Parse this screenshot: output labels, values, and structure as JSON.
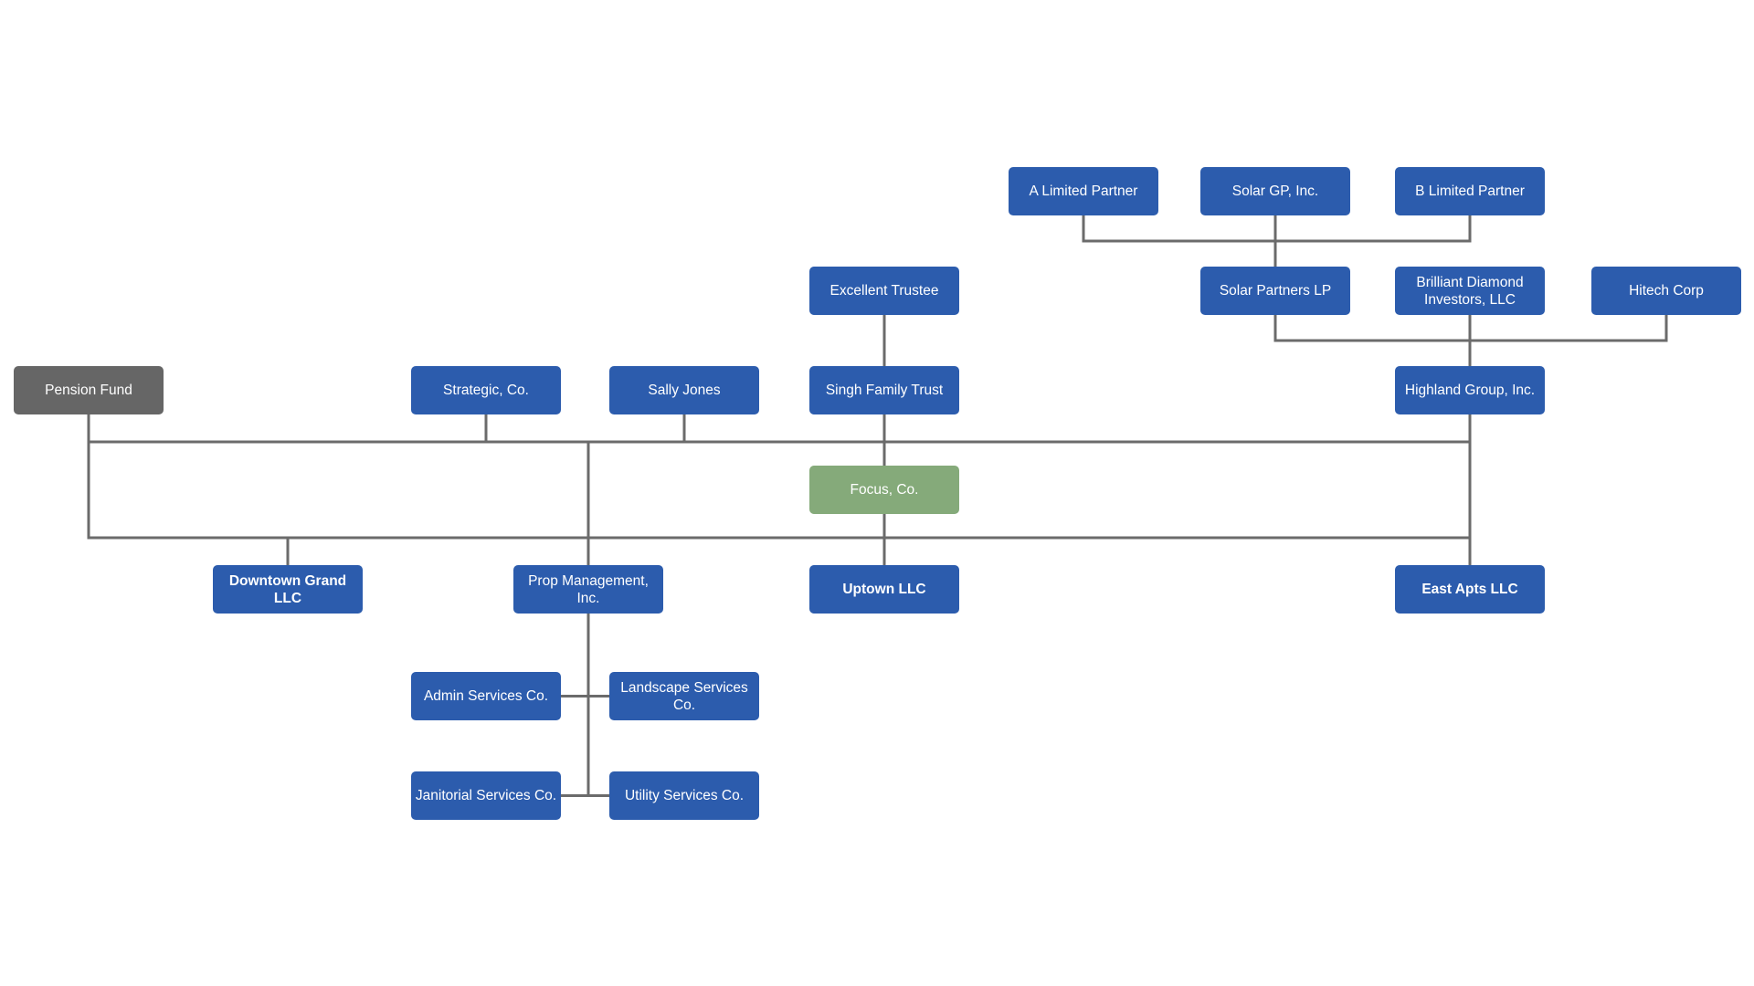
{
  "diagram": {
    "type": "org-chart",
    "colors": {
      "entity": "#2c5cad",
      "focus": "#85aa7a",
      "external": "#666666",
      "line": "#6b6b6b",
      "text": "#ffffff"
    },
    "nodes": [
      {
        "id": "a-limited-partner",
        "label": "A Limited Partner",
        "kind": "entity",
        "bold": false
      },
      {
        "id": "solar-gp",
        "label": "Solar GP, Inc.",
        "kind": "entity",
        "bold": false
      },
      {
        "id": "b-limited-partner",
        "label": "B Limited Partner",
        "kind": "entity",
        "bold": false
      },
      {
        "id": "excellent-trustee",
        "label": "Excellent Trustee",
        "kind": "entity",
        "bold": false
      },
      {
        "id": "solar-partners-lp",
        "label": "Solar Partners LP",
        "kind": "entity",
        "bold": false
      },
      {
        "id": "brilliant-diamond",
        "label": "Brilliant Diamond Investors, LLC",
        "kind": "entity",
        "bold": false
      },
      {
        "id": "hitech-corp",
        "label": "Hitech Corp",
        "kind": "entity",
        "bold": false
      },
      {
        "id": "pension-fund",
        "label": "Pension Fund",
        "kind": "external",
        "bold": false
      },
      {
        "id": "strategic-co",
        "label": "Strategic, Co.",
        "kind": "entity",
        "bold": false
      },
      {
        "id": "sally-jones",
        "label": "Sally Jones",
        "kind": "entity",
        "bold": false
      },
      {
        "id": "singh-family-trust",
        "label": "Singh Family Trust",
        "kind": "entity",
        "bold": false
      },
      {
        "id": "highland-group",
        "label": "Highland Group, Inc.",
        "kind": "entity",
        "bold": false
      },
      {
        "id": "focus-co",
        "label": "Focus, Co.",
        "kind": "focus",
        "bold": false
      },
      {
        "id": "downtown-grand",
        "label": "Downtown Grand LLC",
        "kind": "entity",
        "bold": true
      },
      {
        "id": "prop-management",
        "label": "Prop Management, Inc.",
        "kind": "entity",
        "bold": false
      },
      {
        "id": "uptown-llc",
        "label": "Uptown LLC",
        "kind": "entity",
        "bold": true
      },
      {
        "id": "east-apts",
        "label": "East Apts LLC",
        "kind": "entity",
        "bold": true
      },
      {
        "id": "admin-services",
        "label": "Admin Services Co.",
        "kind": "entity",
        "bold": false
      },
      {
        "id": "landscape-services",
        "label": "Landscape Services Co.",
        "kind": "entity",
        "bold": false
      },
      {
        "id": "janitorial-services",
        "label": "Janitorial Services Co.",
        "kind": "entity",
        "bold": false
      },
      {
        "id": "utility-services",
        "label": "Utility Services Co.",
        "kind": "entity",
        "bold": false
      }
    ],
    "edges": [
      {
        "from": "a-limited-partner",
        "to": "solar-partners-lp"
      },
      {
        "from": "solar-gp",
        "to": "solar-partners-lp"
      },
      {
        "from": "b-limited-partner",
        "to": "solar-partners-lp"
      },
      {
        "from": "solar-partners-lp",
        "to": "highland-group"
      },
      {
        "from": "brilliant-diamond",
        "to": "highland-group"
      },
      {
        "from": "hitech-corp",
        "to": "highland-group"
      },
      {
        "from": "excellent-trustee",
        "to": "singh-family-trust"
      },
      {
        "from": "pension-fund",
        "to": "focus-co"
      },
      {
        "from": "strategic-co",
        "to": "focus-co"
      },
      {
        "from": "sally-jones",
        "to": "focus-co"
      },
      {
        "from": "singh-family-trust",
        "to": "focus-co"
      },
      {
        "from": "highland-group",
        "to": "focus-co"
      },
      {
        "from": "focus-co",
        "to": "downtown-grand"
      },
      {
        "from": "focus-co",
        "to": "prop-management"
      },
      {
        "from": "focus-co",
        "to": "uptown-llc"
      },
      {
        "from": "focus-co",
        "to": "east-apts"
      },
      {
        "from": "pension-fund",
        "to": "downtown-grand"
      },
      {
        "from": "highland-group",
        "to": "east-apts"
      },
      {
        "from": "prop-management",
        "to": "admin-services"
      },
      {
        "from": "prop-management",
        "to": "landscape-services"
      },
      {
        "from": "prop-management",
        "to": "janitorial-services"
      },
      {
        "from": "prop-management",
        "to": "utility-services"
      }
    ]
  }
}
